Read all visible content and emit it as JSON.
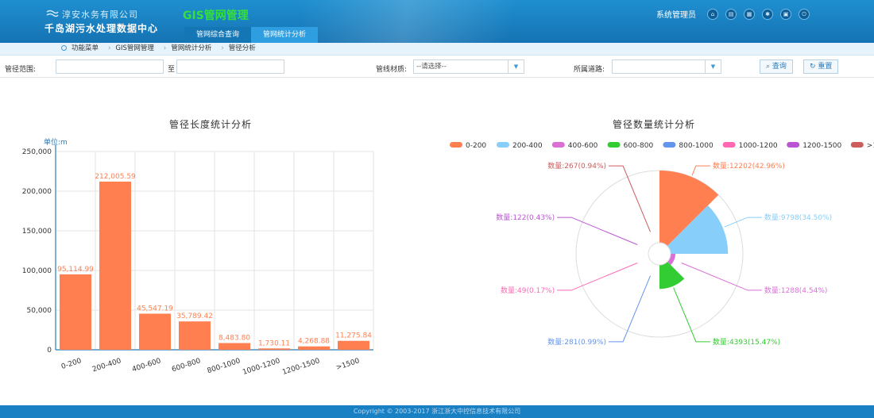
{
  "header": {
    "company": "淳安水务有限公司",
    "subtitle": "千岛湖污水处理数据中心",
    "system_title": "GIS管网管理",
    "tabs": [
      {
        "label": "管网综合查询",
        "active": false
      },
      {
        "label": "管网统计分析",
        "active": true
      }
    ],
    "user": "系统管理员",
    "icons": [
      "home-icon",
      "message-icon",
      "grid-icon",
      "settings-icon",
      "lock-icon",
      "power-icon"
    ]
  },
  "breadcrumb": [
    "功能菜单",
    "GIS管网管理",
    "管网统计分析",
    "管径分析"
  ],
  "filters": {
    "range_label": "管径范围:",
    "range_to": "至",
    "range_from_value": "",
    "range_to_value": "",
    "material_label": "管线材质:",
    "material_value": "--请选择--",
    "road_label": "所属道路:",
    "road_value": "",
    "query_label": "查询",
    "reset_label": "重置"
  },
  "colors": {
    "header": "#1a80c4",
    "bar": "#ff7f50",
    "accent": "#2a7ab8"
  },
  "chart_data": [
    {
      "type": "bar",
      "title": "管径长度统计分析",
      "unit_label": "单位:m",
      "categories": [
        "0-200",
        "200-400",
        "400-600",
        "600-800",
        "800-1000",
        "1000-1200",
        "1200-1500",
        ">1500"
      ],
      "values": [
        95114.99,
        212005.59,
        45547.19,
        35789.42,
        8483.8,
        1730.11,
        4268.88,
        11275.84
      ],
      "value_labels": [
        "95,114.99",
        "212,005.59",
        "45,547.19",
        "35,789.42",
        "8,483.80",
        "1,730.11",
        "4,268.88",
        "11,275.84"
      ],
      "ylim": [
        0,
        250000
      ],
      "yticks": [
        0,
        50000,
        100000,
        150000,
        200000,
        250000
      ],
      "ytick_labels": [
        "0",
        "50,000",
        "100,000",
        "150,000",
        "200,000",
        "250,000"
      ],
      "grid": true
    },
    {
      "type": "pie",
      "subtype": "rose",
      "title": "管径数量统计分析",
      "legend_position": "top",
      "slices": [
        {
          "name": "0-200",
          "value": 12202,
          "label": "数量:12202(42.96%)",
          "color": "#ff7f50"
        },
        {
          "name": "200-400",
          "value": 9798,
          "label": "数量:9798(34.50%)",
          "color": "#87cefa"
        },
        {
          "name": "400-600",
          "value": 1288,
          "label": "数量:1288(4.54%)",
          "color": "#da70d6"
        },
        {
          "name": "600-800",
          "value": 4393,
          "label": "数量:4393(15.47%)",
          "color": "#32cd32"
        },
        {
          "name": "800-1000",
          "value": 281,
          "label": "数量:281(0.99%)",
          "color": "#6495ed"
        },
        {
          "name": "1000-1200",
          "value": 49,
          "label": "数量:49(0.17%)",
          "color": "#ff69b4"
        },
        {
          "name": "1200-1500",
          "value": 122,
          "label": "数量:122(0.43%)",
          "color": "#ba55d3"
        },
        {
          "name": ">1500",
          "value": 267,
          "label": "数量:267(0.94%)",
          "color": "#cd5c5c"
        }
      ]
    }
  ],
  "footer": "Copyright © 2003-2017 浙江浙大中控信息技术有限公司"
}
